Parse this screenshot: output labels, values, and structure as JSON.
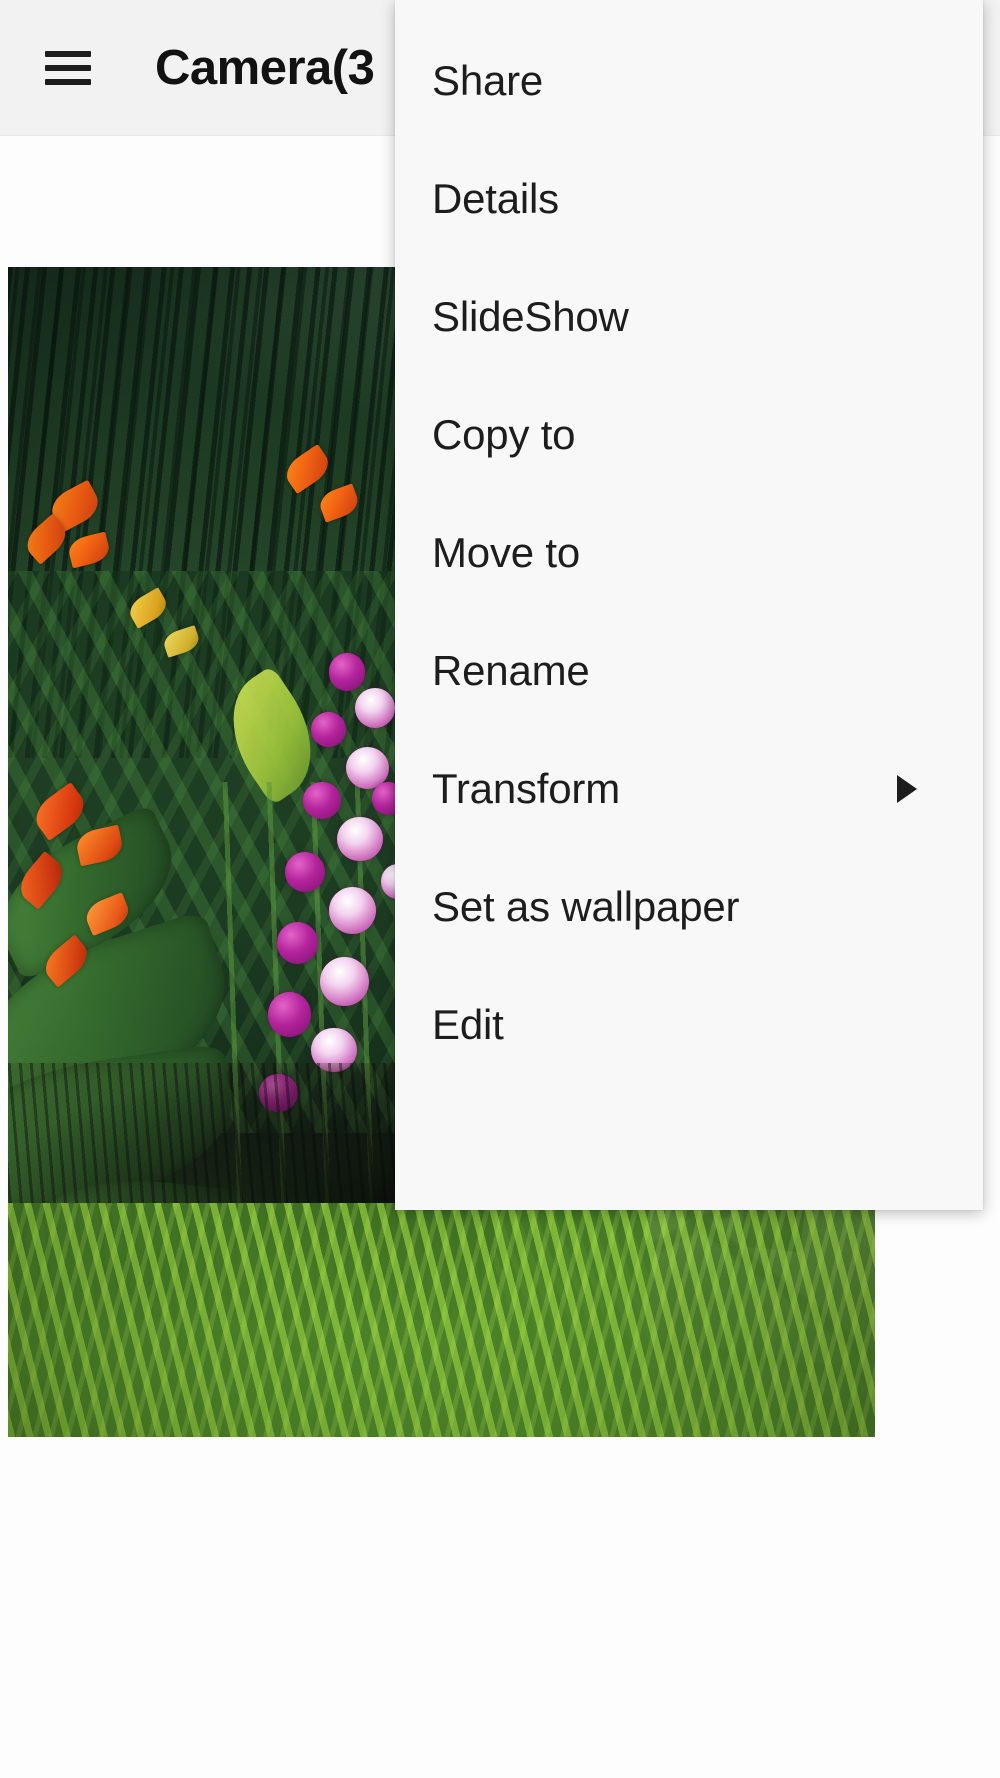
{
  "header": {
    "menu_icon": "hamburger-icon",
    "title": "Camera(3"
  },
  "photo": {
    "alt": "Tropical garden with palms, orange heliconia flowers, purple orchids, green ferns and stone steps"
  },
  "popup_menu": {
    "visible": true,
    "background_color": "#f8f8f8",
    "items": [
      {
        "label": "Share",
        "has_submenu": false
      },
      {
        "label": "Details",
        "has_submenu": false
      },
      {
        "label": "SlideShow",
        "has_submenu": false
      },
      {
        "label": "Copy to",
        "has_submenu": false
      },
      {
        "label": "Move to",
        "has_submenu": false
      },
      {
        "label": "Rename",
        "has_submenu": false
      },
      {
        "label": "Transform",
        "has_submenu": true
      },
      {
        "label": "Set as wallpaper",
        "has_submenu": false
      },
      {
        "label": "Edit",
        "has_submenu": false
      }
    ]
  },
  "colors": {
    "header_background": "#f2f2f2",
    "page_background": "#fdfdfd",
    "menu_background": "#f8f8f8",
    "text_primary": "#1d1d1d",
    "title_text": "#121212"
  }
}
